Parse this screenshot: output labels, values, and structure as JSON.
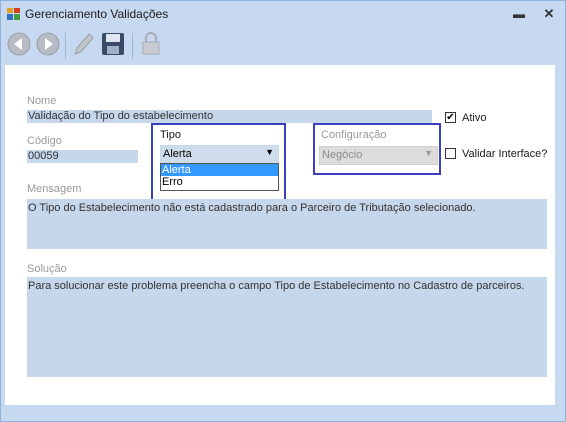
{
  "window": {
    "title": "Gerenciamento Validações",
    "minimize_glyph": "▬",
    "close_glyph": "✕"
  },
  "toolbar": {
    "icons": [
      "back-icon",
      "forward-icon",
      "edit-icon",
      "save-icon",
      "lock-icon"
    ]
  },
  "form": {
    "nome": {
      "label": "Nome",
      "value": "Validação do Tipo do estabelecimento"
    },
    "ativo": {
      "label": "Ativo",
      "checked": true
    },
    "codigo": {
      "label": "Código",
      "value": "00059"
    },
    "tipo": {
      "label": "Tipo",
      "value": "Alerta",
      "options": [
        "Alerta",
        "Erro"
      ],
      "highlighted": "Alerta"
    },
    "configuracao": {
      "label": "Configuração",
      "value": "Negócio"
    },
    "validar_interface": {
      "label": "Validar Interface?",
      "checked": false
    },
    "mensagem": {
      "label": "Mensagem",
      "value": "O Tipo do Estabelecimento não está cadastrado para o Parceiro de Tributação selecionado."
    },
    "solucao": {
      "label": "Solução",
      "value": "Para solucionar este problema preencha o campo Tipo de Estabelecimento no Cadastro de parceiros."
    }
  },
  "colors": {
    "highlight_box": "#3b3fc0",
    "field_bg": "#c6d6eb",
    "frame": "#c6d9f0",
    "selection": "#3399ff"
  }
}
